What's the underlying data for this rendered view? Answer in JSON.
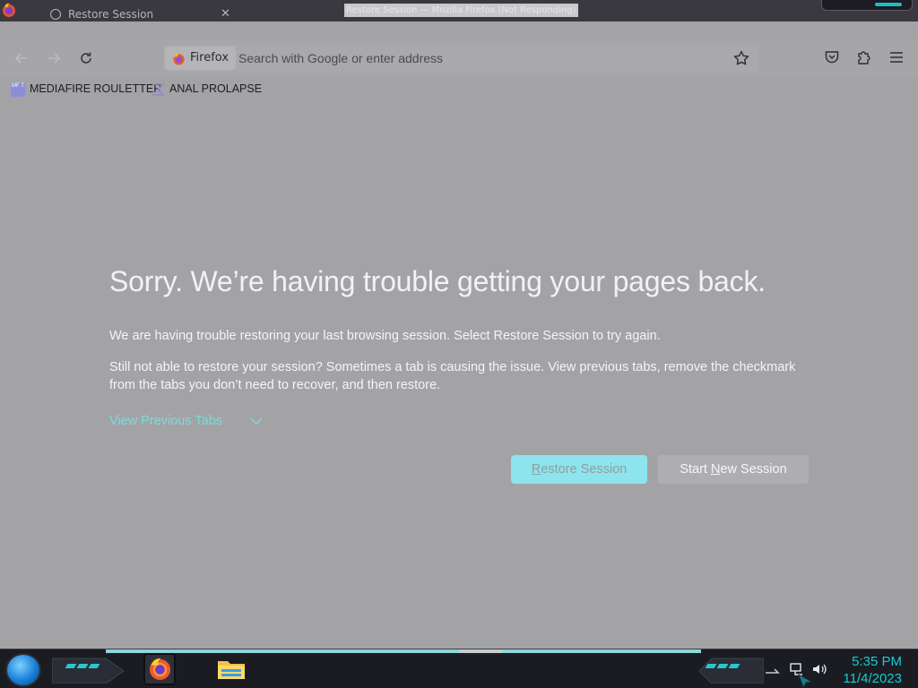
{
  "window": {
    "title": "Restore Session — Mozilla Firefox (Not Responding)",
    "tab_label": "Restore Session"
  },
  "navbar": {
    "back_icon": "arrow-left-icon",
    "forward_icon": "arrow-right-icon",
    "reload_icon": "reload-icon",
    "identity_label": "Firefox",
    "search_placeholder": "Search with Google or enter address",
    "bookmark_star_icon": "star-icon",
    "pocket_icon": "pocket-icon",
    "extensions_icon": "puzzle-icon",
    "menu_icon": "hamburger-icon"
  },
  "bookmarks": [
    {
      "icon_text": "MF T",
      "label": "MEDIAFIRE ROULETTER"
    },
    {
      "label": "ANAL PROLAPSE"
    }
  ],
  "content": {
    "heading": "Sorry. We’re having trouble getting your pages back.",
    "para1": "We are having trouble restoring your last browsing session. Select Restore Session to try again.",
    "para2": "Still not able to restore your session? Sometimes a tab is causing the issue. View previous tabs, remove the checkmark from the tabs you don’t need to recover, and then restore.",
    "view_tabs_label": "View Previous Tabs",
    "restore_button": {
      "accesskey": "R",
      "rest": "estore Session"
    },
    "new_session_button": {
      "before": "Start ",
      "accesskey": "N",
      "rest": "ew Session"
    }
  },
  "taskbar": {
    "clock_time": "5:35 PM",
    "clock_date": "11/4/2023"
  },
  "colors": {
    "page_background": "#a3a3a6",
    "accent": "#7fd8de",
    "primary_button": "#8de4ec",
    "taskbar_accent": "#19cbd3"
  }
}
